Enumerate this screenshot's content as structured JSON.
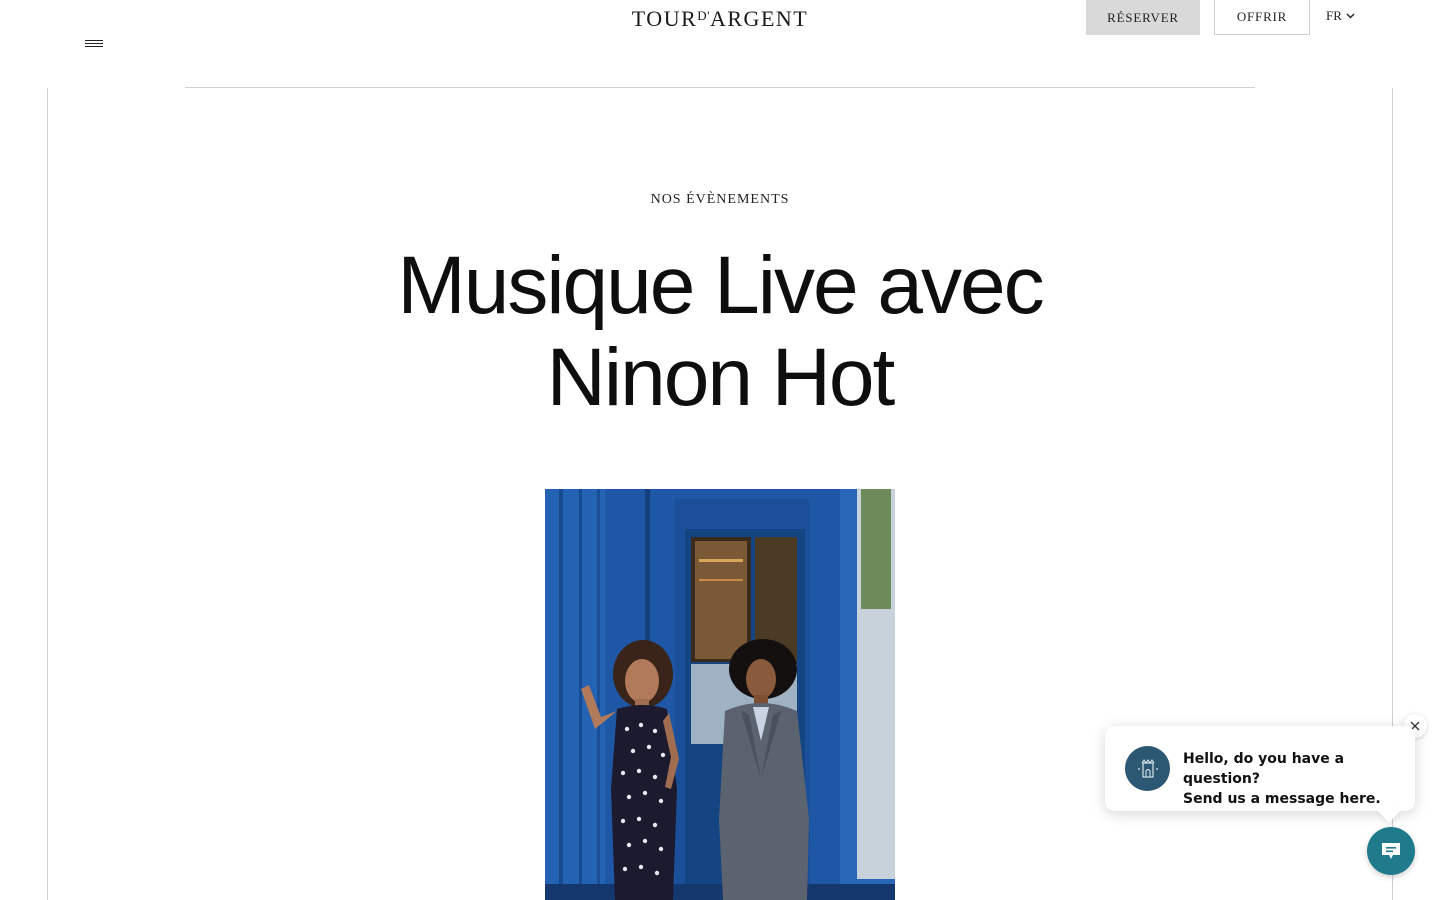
{
  "header": {
    "logo_main": "TOUR",
    "logo_small": "D'",
    "logo_end": "ARGENT",
    "reserve_label": "RÉSERVER",
    "offer_label": "OFFRIR",
    "language": "FR"
  },
  "main": {
    "eyebrow": "NOS ÉVÈNEMENTS",
    "title_line1": "Musique Live avec",
    "title_line2": "Ninon Hot"
  },
  "chat": {
    "message_line1": "Hello, do you have a question?",
    "message_line2": "Send us a message here."
  },
  "colors": {
    "reserve_bg": "#d9d9d9",
    "chat_accent": "#1f7a8c",
    "photo_blue": "#1f5aa8"
  },
  "icons": {
    "menu": "hamburger-icon",
    "language": "chevron-down-icon",
    "close": "close-icon",
    "chat": "chat-icon"
  }
}
